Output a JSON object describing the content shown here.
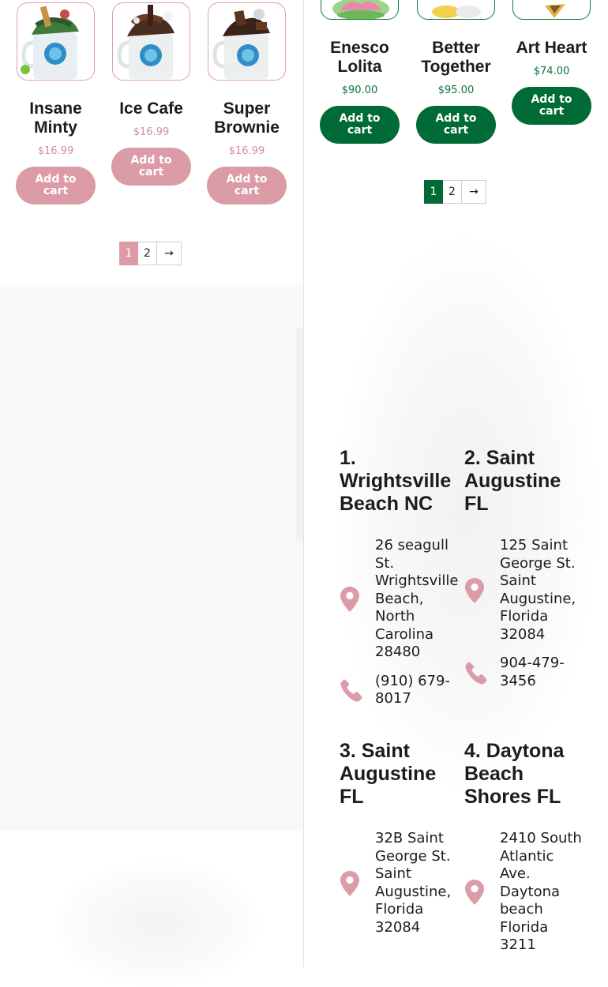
{
  "left_products": [
    {
      "name": "Insane Minty",
      "price": "$16.99",
      "button": "Add to cart"
    },
    {
      "name": "Ice Cafe",
      "price": "$16.99",
      "button": "Add to cart"
    },
    {
      "name": "Super Brownie",
      "price": "$16.99",
      "button": "Add to cart"
    }
  ],
  "left_pagination": {
    "current": "1",
    "next_page": "2",
    "next_arrow": "→"
  },
  "right_products": [
    {
      "name": "Enesco Lolita",
      "price": "$90.00",
      "button": "Add to cart"
    },
    {
      "name": "Better Together",
      "price": "$95.00",
      "button": "Add to cart"
    },
    {
      "name": "Art Heart",
      "price": "$74.00",
      "button": "Add to cart"
    }
  ],
  "right_pagination": {
    "current": "1",
    "next_page": "2",
    "next_arrow": "→"
  },
  "locations": [
    {
      "title": "1. Wrightsville Beach NC",
      "address": "26 seagull St. Wrightsville Beach, North Carolina 28480",
      "phone": "(910) 679-8017"
    },
    {
      "title": "2. Saint Augustine FL",
      "address": "125 Saint George St. Saint Augustine, Florida 32084",
      "phone": "904-479-3456"
    },
    {
      "title": "3. Saint Augustine FL",
      "address": "32B Saint George St. Saint Augustine, Florida 32084"
    },
    {
      "title": "4. Daytona Beach Shores FL",
      "address": "2410 South Atlantic Ave. Daytona beach Florida 3211"
    }
  ],
  "colors": {
    "pink_accent": "#dc9ca7",
    "green_accent": "#006b35",
    "pin_icon": "#dc9ca7"
  },
  "icons": {
    "address": "map-pin-icon",
    "phone": "phone-icon"
  }
}
